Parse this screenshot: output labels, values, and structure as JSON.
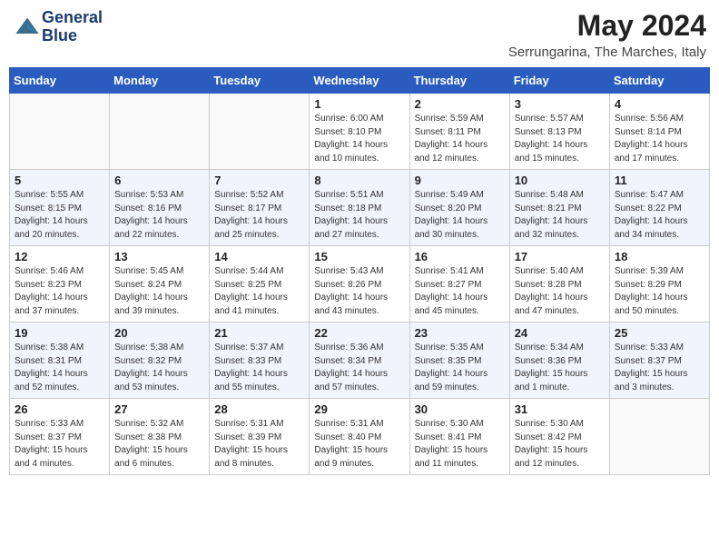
{
  "header": {
    "logo_line1": "General",
    "logo_line2": "Blue",
    "month": "May 2024",
    "location": "Serrungarina, The Marches, Italy"
  },
  "weekdays": [
    "Sunday",
    "Monday",
    "Tuesday",
    "Wednesday",
    "Thursday",
    "Friday",
    "Saturday"
  ],
  "weeks": [
    [
      {
        "day": "",
        "info": ""
      },
      {
        "day": "",
        "info": ""
      },
      {
        "day": "",
        "info": ""
      },
      {
        "day": "1",
        "info": "Sunrise: 6:00 AM\nSunset: 8:10 PM\nDaylight: 14 hours\nand 10 minutes."
      },
      {
        "day": "2",
        "info": "Sunrise: 5:59 AM\nSunset: 8:11 PM\nDaylight: 14 hours\nand 12 minutes."
      },
      {
        "day": "3",
        "info": "Sunrise: 5:57 AM\nSunset: 8:13 PM\nDaylight: 14 hours\nand 15 minutes."
      },
      {
        "day": "4",
        "info": "Sunrise: 5:56 AM\nSunset: 8:14 PM\nDaylight: 14 hours\nand 17 minutes."
      }
    ],
    [
      {
        "day": "5",
        "info": "Sunrise: 5:55 AM\nSunset: 8:15 PM\nDaylight: 14 hours\nand 20 minutes."
      },
      {
        "day": "6",
        "info": "Sunrise: 5:53 AM\nSunset: 8:16 PM\nDaylight: 14 hours\nand 22 minutes."
      },
      {
        "day": "7",
        "info": "Sunrise: 5:52 AM\nSunset: 8:17 PM\nDaylight: 14 hours\nand 25 minutes."
      },
      {
        "day": "8",
        "info": "Sunrise: 5:51 AM\nSunset: 8:18 PM\nDaylight: 14 hours\nand 27 minutes."
      },
      {
        "day": "9",
        "info": "Sunrise: 5:49 AM\nSunset: 8:20 PM\nDaylight: 14 hours\nand 30 minutes."
      },
      {
        "day": "10",
        "info": "Sunrise: 5:48 AM\nSunset: 8:21 PM\nDaylight: 14 hours\nand 32 minutes."
      },
      {
        "day": "11",
        "info": "Sunrise: 5:47 AM\nSunset: 8:22 PM\nDaylight: 14 hours\nand 34 minutes."
      }
    ],
    [
      {
        "day": "12",
        "info": "Sunrise: 5:46 AM\nSunset: 8:23 PM\nDaylight: 14 hours\nand 37 minutes."
      },
      {
        "day": "13",
        "info": "Sunrise: 5:45 AM\nSunset: 8:24 PM\nDaylight: 14 hours\nand 39 minutes."
      },
      {
        "day": "14",
        "info": "Sunrise: 5:44 AM\nSunset: 8:25 PM\nDaylight: 14 hours\nand 41 minutes."
      },
      {
        "day": "15",
        "info": "Sunrise: 5:43 AM\nSunset: 8:26 PM\nDaylight: 14 hours\nand 43 minutes."
      },
      {
        "day": "16",
        "info": "Sunrise: 5:41 AM\nSunset: 8:27 PM\nDaylight: 14 hours\nand 45 minutes."
      },
      {
        "day": "17",
        "info": "Sunrise: 5:40 AM\nSunset: 8:28 PM\nDaylight: 14 hours\nand 47 minutes."
      },
      {
        "day": "18",
        "info": "Sunrise: 5:39 AM\nSunset: 8:29 PM\nDaylight: 14 hours\nand 50 minutes."
      }
    ],
    [
      {
        "day": "19",
        "info": "Sunrise: 5:38 AM\nSunset: 8:31 PM\nDaylight: 14 hours\nand 52 minutes."
      },
      {
        "day": "20",
        "info": "Sunrise: 5:38 AM\nSunset: 8:32 PM\nDaylight: 14 hours\nand 53 minutes."
      },
      {
        "day": "21",
        "info": "Sunrise: 5:37 AM\nSunset: 8:33 PM\nDaylight: 14 hours\nand 55 minutes."
      },
      {
        "day": "22",
        "info": "Sunrise: 5:36 AM\nSunset: 8:34 PM\nDaylight: 14 hours\nand 57 minutes."
      },
      {
        "day": "23",
        "info": "Sunrise: 5:35 AM\nSunset: 8:35 PM\nDaylight: 14 hours\nand 59 minutes."
      },
      {
        "day": "24",
        "info": "Sunrise: 5:34 AM\nSunset: 8:36 PM\nDaylight: 15 hours\nand 1 minute."
      },
      {
        "day": "25",
        "info": "Sunrise: 5:33 AM\nSunset: 8:37 PM\nDaylight: 15 hours\nand 3 minutes."
      }
    ],
    [
      {
        "day": "26",
        "info": "Sunrise: 5:33 AM\nSunset: 8:37 PM\nDaylight: 15 hours\nand 4 minutes."
      },
      {
        "day": "27",
        "info": "Sunrise: 5:32 AM\nSunset: 8:38 PM\nDaylight: 15 hours\nand 6 minutes."
      },
      {
        "day": "28",
        "info": "Sunrise: 5:31 AM\nSunset: 8:39 PM\nDaylight: 15 hours\nand 8 minutes."
      },
      {
        "day": "29",
        "info": "Sunrise: 5:31 AM\nSunset: 8:40 PM\nDaylight: 15 hours\nand 9 minutes."
      },
      {
        "day": "30",
        "info": "Sunrise: 5:30 AM\nSunset: 8:41 PM\nDaylight: 15 hours\nand 11 minutes."
      },
      {
        "day": "31",
        "info": "Sunrise: 5:30 AM\nSunset: 8:42 PM\nDaylight: 15 hours\nand 12 minutes."
      },
      {
        "day": "",
        "info": ""
      }
    ]
  ]
}
